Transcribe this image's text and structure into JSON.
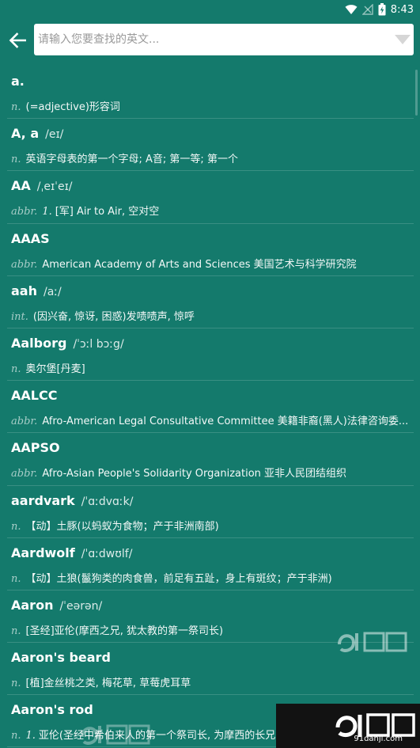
{
  "status_bar": {
    "time": "8:43",
    "wifi_icon": "wifi-icon",
    "signal_icon": "no-signal-icon",
    "battery_icon": "battery-charging-icon"
  },
  "toolbar": {
    "back_icon": "arrow-left-icon",
    "search_placeholder": "请输入您要查找的英文...",
    "search_value": "",
    "dropdown_icon": "triangle-down-icon"
  },
  "entries": [
    {
      "word": "a.",
      "phonetic": "",
      "pos": "n.",
      "sense": "",
      "definition": "(=adjective)形容词"
    },
    {
      "word": "A, a",
      "phonetic": "/eɪ/",
      "pos": "n.",
      "sense": "",
      "definition": "英语字母表的第一个字母; A音; 第一等; 第一个"
    },
    {
      "word": "AA",
      "phonetic": "/ˌeɪˈeɪ/",
      "pos": "abbr.",
      "sense": "1.",
      "definition": "[军] Air to Air, 空对空"
    },
    {
      "word": "AAAS",
      "phonetic": "",
      "pos": "abbr.",
      "sense": "",
      "definition": "American Academy of Arts and Sciences 美国艺术与科学研究院"
    },
    {
      "word": "aah",
      "phonetic": "/aː/",
      "pos": "int.",
      "sense": "",
      "definition": "(因兴奋, 惊讶, 困惑)发啧啧声, 惊呼"
    },
    {
      "word": "Aalborg",
      "phonetic": "/ˈɔːl bɔːg/",
      "pos": "n.",
      "sense": "",
      "definition": "奥尔堡[丹麦]"
    },
    {
      "word": "AALCC",
      "phonetic": "",
      "pos": "abbr.",
      "sense": "",
      "definition": "Afro-American Legal Consultative Committee 美籍非裔(黑人)法律咨询委..."
    },
    {
      "word": "AAPSO",
      "phonetic": "",
      "pos": "abbr.",
      "sense": "",
      "definition": "Afro-Asian People's Solidarity Organization 亚非人民团结组织"
    },
    {
      "word": "aardvark",
      "phonetic": "/ˈɑːdvɑːk/",
      "pos": "n.",
      "sense": "",
      "definition": "【动】土豚(以蚂蚁为食物；产于非洲南部)"
    },
    {
      "word": "Aardwolf",
      "phonetic": "/ˈɑːdwʊlf/",
      "pos": "n.",
      "sense": "",
      "definition": "【动】土狼(鬣狗类的肉食兽，前足有五趾，身上有斑纹；产于非洲)"
    },
    {
      "word": "Aaron",
      "phonetic": "/ˈeərən/",
      "pos": "n.",
      "sense": "",
      "definition": "[圣经]亚伦(摩西之兄, 犹太教的第一祭司长)"
    },
    {
      "word": "Aaron's beard",
      "phonetic": "",
      "pos": "n.",
      "sense": "",
      "definition": "[植]金丝桃之类, 梅花草, 草莓虎耳草"
    },
    {
      "word": "Aaron's rod",
      "phonetic": "",
      "pos": "n.",
      "sense": "1.",
      "definition": "亚伦(圣经中希伯来人的第一个祭司长, 为摩西的长兄)的"
    }
  ],
  "watermark": {
    "brand": "91游戏",
    "site": "91danji.com"
  }
}
